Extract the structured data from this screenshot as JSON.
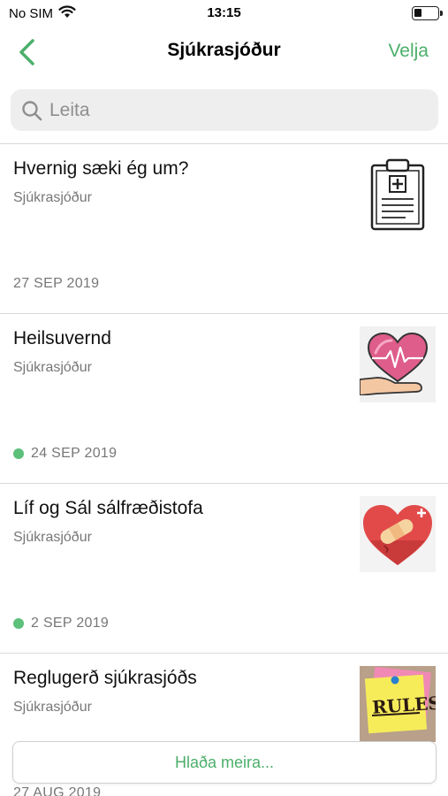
{
  "status_bar": {
    "carrier": "No SIM",
    "time": "13:15"
  },
  "nav": {
    "title": "Sjúkrasjóður",
    "action_label": "Velja"
  },
  "search": {
    "placeholder": "Leita"
  },
  "items": [
    {
      "title": "Hvernig sæki ég um?",
      "subtitle": "Sjúkrasjóður",
      "date": "27 SEP 2019",
      "unread": false,
      "thumbnail": "clipboard-icon"
    },
    {
      "title": "Heilsuvernd",
      "subtitle": "Sjúkrasjóður",
      "date": "24 SEP 2019",
      "unread": true,
      "thumbnail": "heart-hand-icon"
    },
    {
      "title": "Líf og Sál sálfræðistofa",
      "subtitle": "Sjúkrasjóður",
      "date": "2 SEP 2019",
      "unread": true,
      "thumbnail": "bandaged-heart-icon"
    },
    {
      "title": "Reglugerð sjúkrasjóðs",
      "subtitle": "Sjúkrasjóður",
      "date": "27 AUG 2019",
      "unread": false,
      "thumbnail": "rules-note-icon"
    }
  ],
  "load_more_label": "Hlaða meira...",
  "colors": {
    "accent": "#4caf6a",
    "unread_dot": "#5cc07a"
  }
}
